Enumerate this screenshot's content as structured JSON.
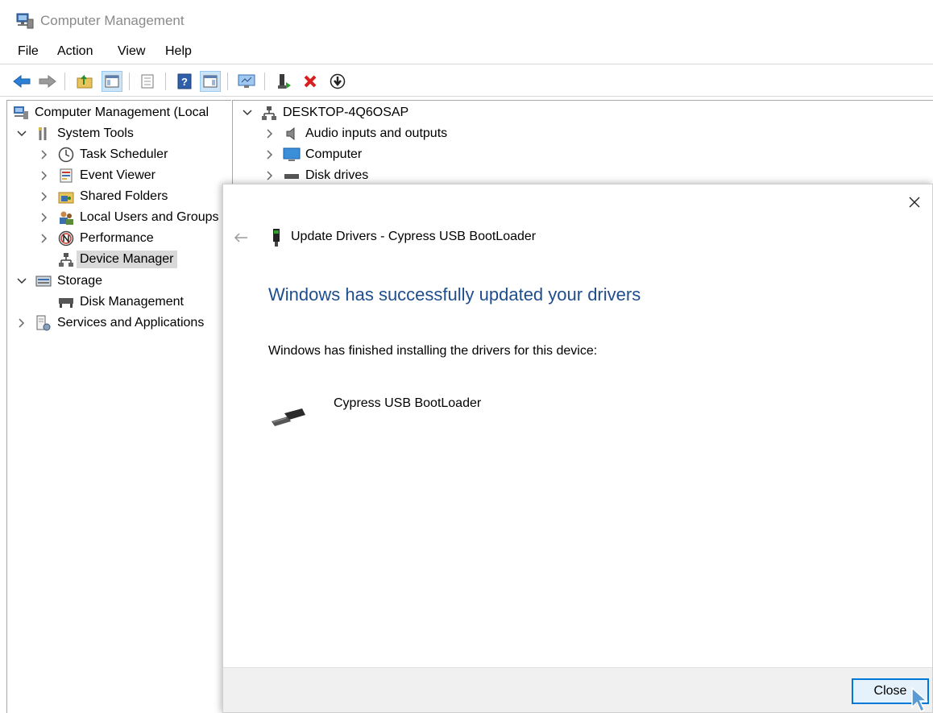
{
  "window": {
    "title": "Computer Management",
    "icon": "computer-management-icon"
  },
  "menu": [
    "File",
    "Action",
    "View",
    "Help"
  ],
  "toolbar": {
    "buttons": [
      "back-icon",
      "forward-icon",
      "up-folder-icon",
      "show-hide-tree-icon",
      "properties-icon",
      "help-icon",
      "action-pane-icon",
      "monitor-icon",
      "enable-device-icon",
      "uninstall-icon",
      "update-driver-icon"
    ]
  },
  "tree": {
    "root": "Computer Management (Local",
    "system_tools": "System Tools",
    "task_scheduler": "Task Scheduler",
    "event_viewer": "Event Viewer",
    "shared_folders": "Shared Folders",
    "local_users": "Local Users and Groups",
    "performance": "Performance",
    "device_manager": "Device Manager",
    "storage": "Storage",
    "disk_management": "Disk Management",
    "services": "Services and Applications"
  },
  "devices": {
    "computer_name": "DESKTOP-4Q6OSAP",
    "audio": "Audio inputs and outputs",
    "computer": "Computer",
    "disk_drives": "Disk drives"
  },
  "dialog": {
    "title": "Update Drivers - Cypress USB BootLoader",
    "heading": "Windows has successfully updated your drivers",
    "message": "Windows has finished installing the drivers for this device:",
    "device_name": "Cypress USB BootLoader",
    "close_button": "Close"
  },
  "colors": {
    "heading_blue": "#1f4e8c",
    "button_border": "#0078d7",
    "selection": "#d9d9d9"
  }
}
